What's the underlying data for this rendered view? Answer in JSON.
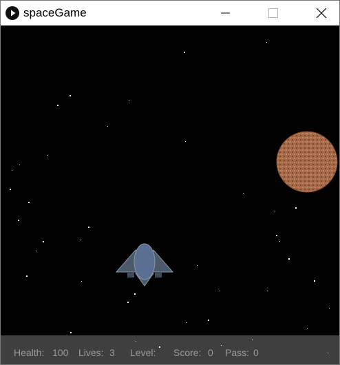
{
  "window": {
    "title": "spaceGame"
  },
  "icons": {
    "app": "play-icon",
    "minimize": "minimize-icon",
    "maximize": "maximize-icon",
    "close": "close-icon"
  },
  "colors": {
    "space": "#000000",
    "hud_bar": "#3f3f3f",
    "hud_text": "#9a9a9a",
    "ship_wing": "#4b5a6b",
    "ship_body": "#5a6f92",
    "asteroid": "#a46a48"
  },
  "hud": {
    "health_label": "Health:",
    "health_value": "100",
    "lives_label": "Lives:",
    "lives_value": "3",
    "level_label": "Level:",
    "level_value": "",
    "score_label": "Score:",
    "score_value": "0",
    "pass_label": "Pass:",
    "pass_value": "0"
  }
}
